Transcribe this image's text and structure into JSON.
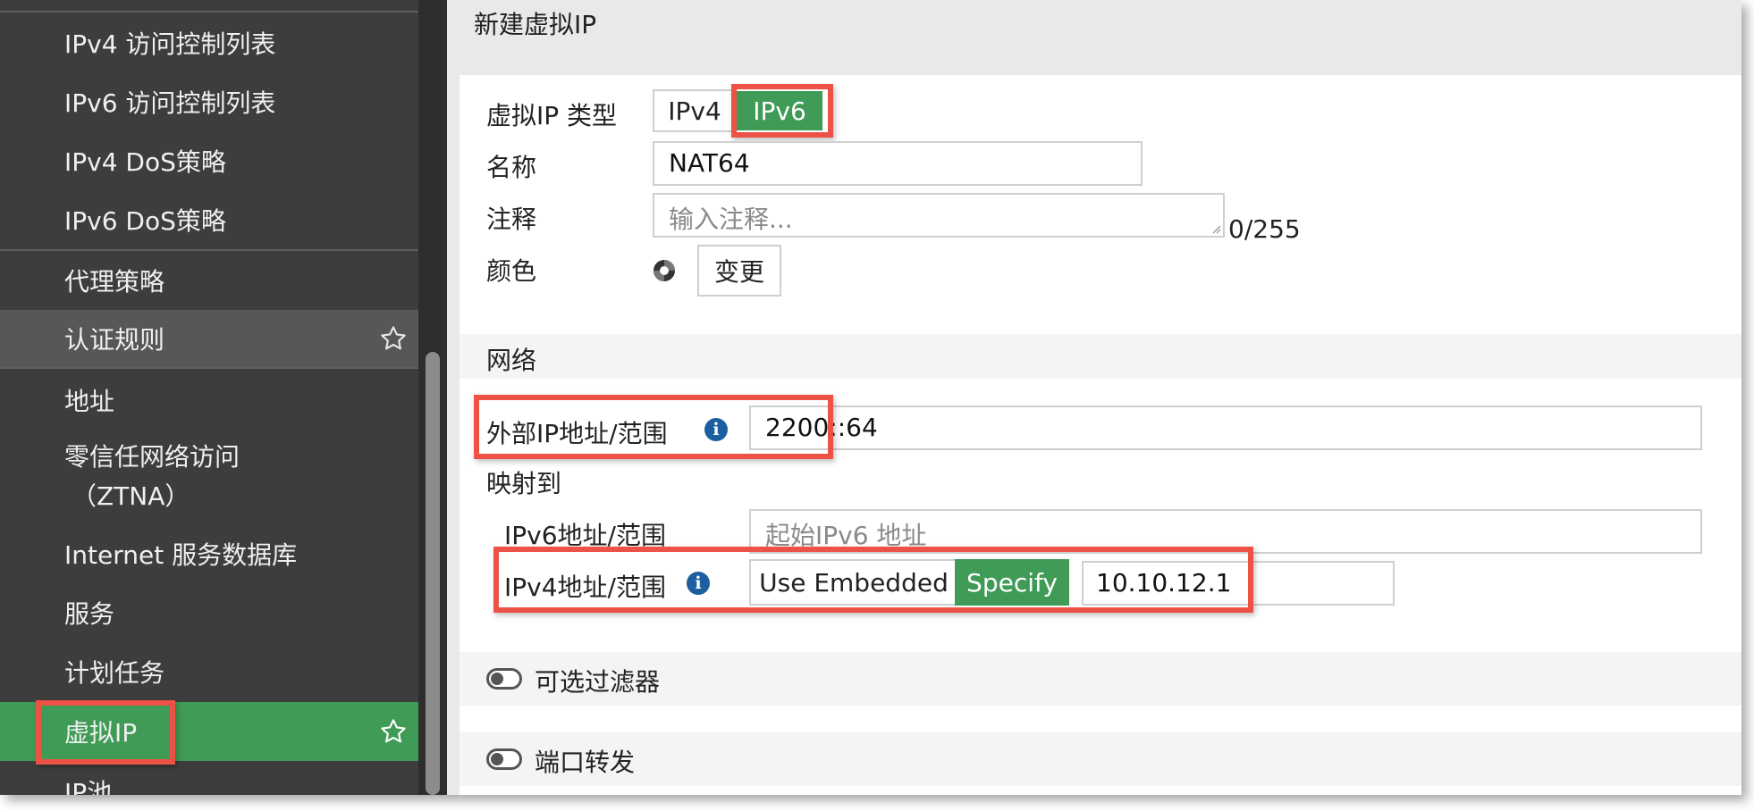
{
  "sidebar": {
    "items": [
      {
        "label": "IPv4 访问控制列表"
      },
      {
        "label": "IPv6 访问控制列表"
      },
      {
        "label": "IPv4 DoS策略"
      },
      {
        "label": "IPv6 DoS策略"
      },
      {
        "label": "代理策略"
      },
      {
        "label": "认证规则"
      },
      {
        "label": "地址"
      },
      {
        "label": "零信任网络访问"
      },
      {
        "label": "（ZTNA）"
      },
      {
        "label": "Internet 服务数据库"
      },
      {
        "label": "服务"
      },
      {
        "label": "计划任务"
      },
      {
        "label": "虚拟IP"
      },
      {
        "label": "IP池"
      }
    ]
  },
  "form": {
    "title": "新建虚拟IP",
    "vip_type_label": "虚拟IP 类型",
    "vip_type_options": [
      "IPv4",
      "IPv6"
    ],
    "vip_type_selected": "IPv6",
    "name_label": "名称",
    "name_value": "NAT64",
    "comment_label": "注释",
    "comment_placeholder": "输入注释...",
    "comment_counter": "0/255",
    "color_label": "颜色",
    "color_change_button": "变更",
    "network_section": "网络",
    "external_ip_label": "外部IP地址/范围",
    "external_ip_value": "2200::64",
    "mapped_to_label": "映射到",
    "ipv6_range_label": "IPv6地址/范围",
    "ipv6_range_placeholder": "起始IPv6 地址",
    "ipv4_range_label": "IPv4地址/范围",
    "ipv4_mode_options": [
      "Use Embedded",
      "Specify"
    ],
    "ipv4_mode_selected": "Specify",
    "ipv4_range_value": "10.10.12.1",
    "optional_filters_label": "可选过滤器",
    "port_forwarding_label": "端口转发"
  },
  "colors": {
    "accent_green": "#3f9b55",
    "highlight_red": "#ee5246",
    "sidebar_bg": "#3d3d3d",
    "info_blue": "#1c5fa0"
  }
}
